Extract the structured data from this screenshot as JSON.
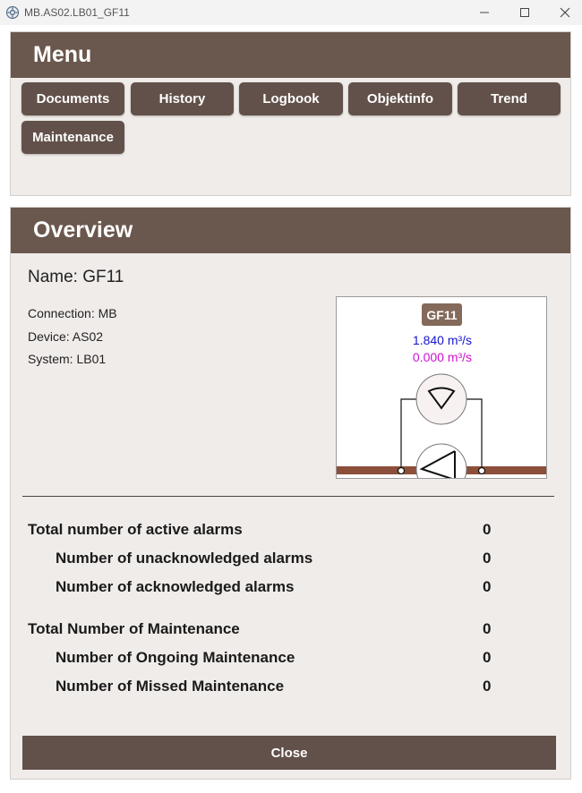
{
  "window": {
    "title": "MB.AS02.LB01_GF11",
    "icon": "app-gear-icon"
  },
  "menu": {
    "title": "Menu",
    "buttons": [
      "Documents",
      "History",
      "Logbook",
      "Objektinfo",
      "Trend",
      "Maintenance"
    ]
  },
  "overview": {
    "title": "Overview",
    "name_line": "Name: GF11",
    "connection": "Connection: MB",
    "device": "Device: AS02",
    "system": "System: LB01",
    "symbol": {
      "tag": "GF11",
      "flow_primary": "1.840 m³/s",
      "flow_secondary": "0.000 m³/s",
      "colors": {
        "flow_primary": "#1515d0",
        "flow_secondary": "#d010d0",
        "duct": "#8b4f3a",
        "tag_bg": "#836a5a"
      }
    },
    "stats": [
      {
        "label": "Total number of active alarms",
        "value": "0"
      },
      {
        "label": "Number of unacknowledged alarms",
        "value": "0"
      },
      {
        "label": "Number of acknowledged alarms",
        "value": "0"
      },
      {
        "label": "Total Number of Maintenance",
        "value": "0"
      },
      {
        "label": "Number of Ongoing Maintenance",
        "value": "0"
      },
      {
        "label": "Number of Missed Maintenance",
        "value": "0"
      }
    ],
    "close_label": "Close"
  },
  "theme": {
    "header_bg": "#6a574d",
    "button_bg": "#62514a",
    "panel_bg": "#f0ecea"
  }
}
